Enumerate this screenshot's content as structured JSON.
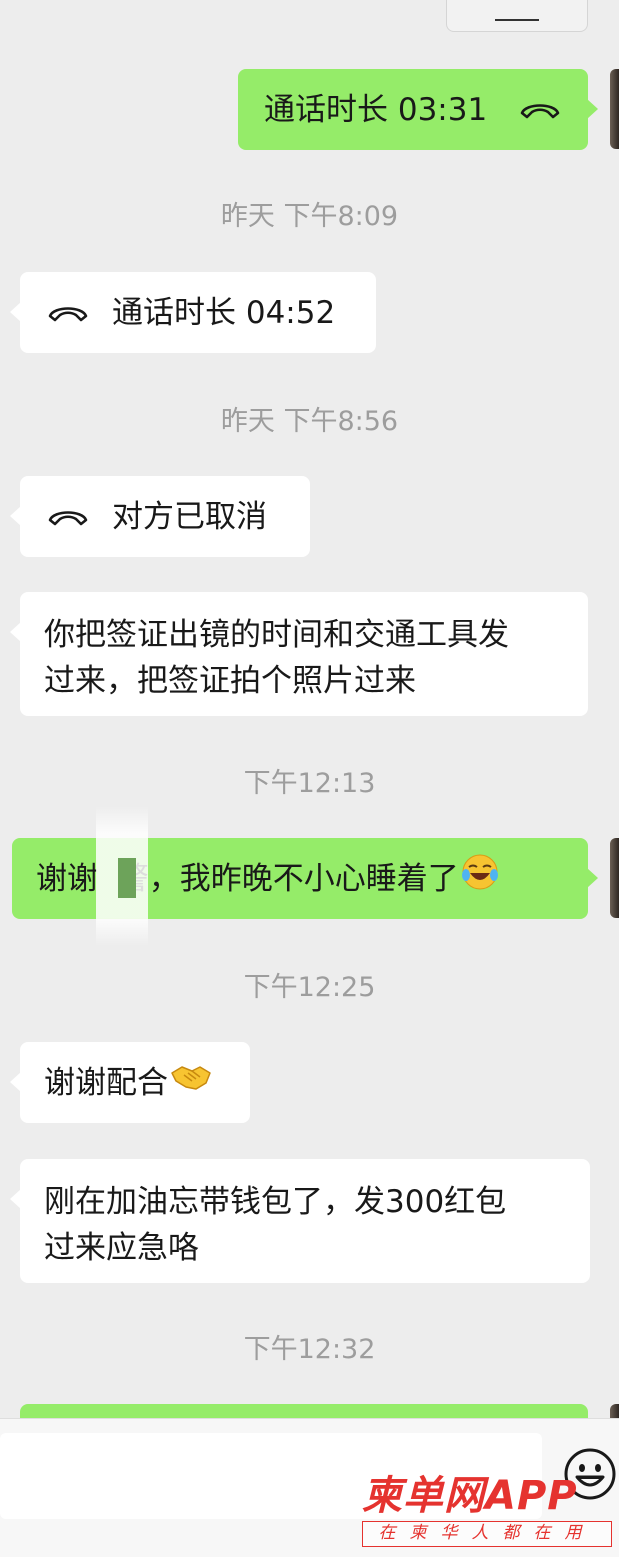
{
  "messages": [
    {
      "kind": "call",
      "side": "right",
      "text": "通话时长 03:31"
    },
    {
      "kind": "time",
      "text": "昨天 下午8:09"
    },
    {
      "kind": "call",
      "side": "left",
      "text": "通话时长 04:52"
    },
    {
      "kind": "time",
      "text": "昨天 下午8:56"
    },
    {
      "kind": "call",
      "side": "left",
      "text": "对方已取消"
    },
    {
      "kind": "text",
      "side": "left",
      "lines": [
        "你把签证出镜的时间和交通工具发",
        "过来，把签证拍个照片过来"
      ]
    },
    {
      "kind": "time",
      "text": "下午12:13"
    },
    {
      "kind": "text",
      "side": "right",
      "text": "谢谢  警，我昨晚不小心睡着了",
      "emoji": "laughing-crying-emoji"
    },
    {
      "kind": "time",
      "text": "下午12:25"
    },
    {
      "kind": "text",
      "side": "left",
      "text": "谢谢配合",
      "emoji": "handshake-emoji"
    },
    {
      "kind": "text",
      "side": "left",
      "lines": [
        "刚在加油忘带钱包了，发300红包",
        "过来应急咯"
      ]
    },
    {
      "kind": "time",
      "text": "下午12:32"
    }
  ],
  "input": {
    "emoji_button_icon": "smiley-face-icon"
  },
  "watermark": {
    "logo": "柬单网APP",
    "tagline": "在柬华人都在用"
  },
  "colors": {
    "background": "#ededed",
    "sent_bubble": "#95ec69",
    "received_bubble": "#ffffff",
    "timestamp": "#9d9d9d",
    "watermark": "#e5332f"
  }
}
